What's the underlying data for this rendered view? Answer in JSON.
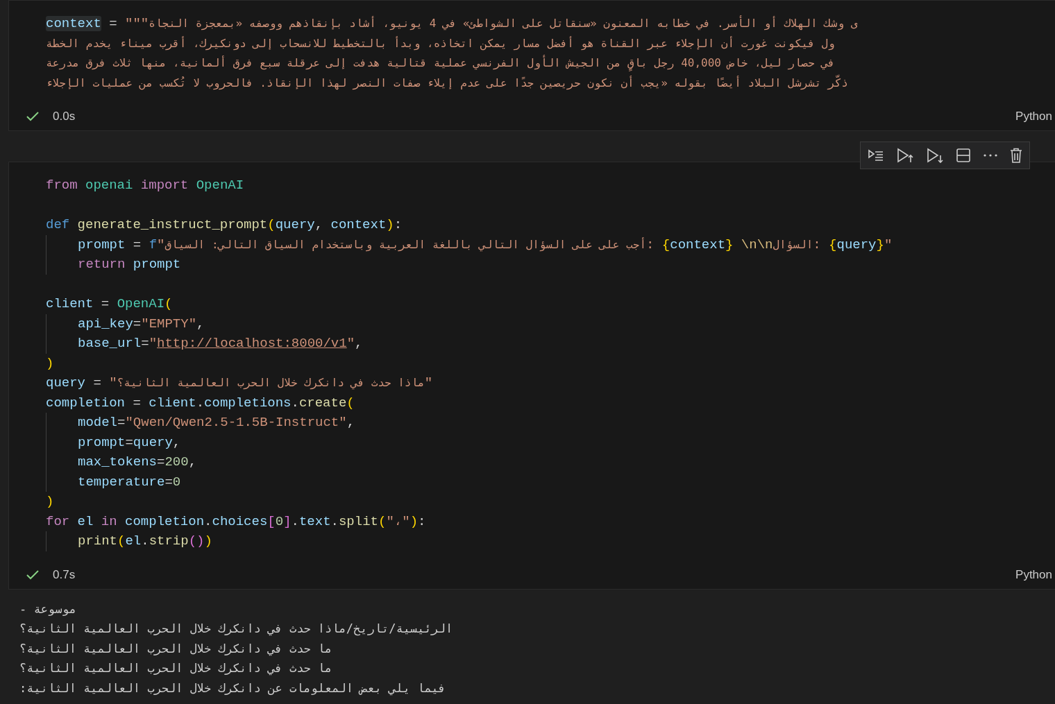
{
  "cells": [
    {
      "kind": "code",
      "lines": [
        {
          "kind": "code",
          "tokens": [
            {
              "t": "context",
              "kind": "varhl"
            },
            {
              "t": " = ",
              "kind": "op"
            },
            {
              "t": "\"\"\"",
              "kind": "str"
            },
            {
              "t": "ى وشك الهلاك أو الأسر. في خطابه المعنون «سنقاتل على الشواطئ» في 4 يونيو، أشاد بإنقاذهم ووصفه «بمعجزة النجاة",
              "kind": "ar"
            }
          ]
        },
        {
          "kind": "code",
          "tokens": [
            {
              "t": "ول فيكونت غورت أن الإجلاء عبر القناة هو أفضل مسار يمكن اتخاذه، وبدأ بالتخطيط للانسحاب إلى دونكيرك، أقرب ميناء يخدم الخطة",
              "kind": "ar"
            }
          ]
        },
        {
          "kind": "code",
          "tokens": [
            {
              "t": "في حصار ليل، خاض 40,000 رجل باقٍ من الجيش الأول الفرنسي عملية قتالية هدفت إلى عرقلة سبع فرق ألمانية، منها ثلاث فرق مدرعة",
              "kind": "ar"
            }
          ]
        },
        {
          "kind": "code",
          "tokens": [
            {
              "t": "ذكّر تشرشل البلاد أيضًا بقوله «يجب أن نكون حريصين جدًا على عدم إيلاء صفات النصر لهذا الإنقاذ. فالحروب لا تُكسب من عمليات الإجلاء",
              "kind": "ar"
            }
          ]
        }
      ],
      "succeeded": true,
      "time": "0.0s",
      "language": "Python",
      "toolbar": false
    },
    {
      "kind": "code",
      "lines": [
        {
          "kind": "code",
          "tokens": [
            {
              "t": "from ",
              "kind": "kw"
            },
            {
              "t": "openai ",
              "kind": "cls"
            },
            {
              "t": "import ",
              "kind": "kw"
            },
            {
              "t": "OpenAI",
              "kind": "cls"
            }
          ]
        },
        {
          "kind": "blank"
        },
        {
          "kind": "code",
          "tokens": [
            {
              "t": "def ",
              "kind": "kw2"
            },
            {
              "t": "generate_instruct_prompt",
              "kind": "fn"
            },
            {
              "t": "(",
              "kind": "br1"
            },
            {
              "t": "query",
              "kind": "var"
            },
            {
              "t": ", ",
              "kind": "op"
            },
            {
              "t": "context",
              "kind": "var"
            },
            {
              "t": ")",
              "kind": "br1"
            },
            {
              "t": ":",
              "kind": "op"
            }
          ],
          "children": [
            {
              "kind": "code",
              "tokens": [
                {
                  "t": "prompt",
                  "kind": "var"
                },
                {
                  "t": " = ",
                  "kind": "op"
                },
                {
                  "t": "f",
                  "kind": "kw2"
                },
                {
                  "t": "\"",
                  "kind": "str"
                },
                {
                  "t": "أجب على على السؤال التالي باللغة العربية وباستخدام السياق التالي: السياق",
                  "kind": "ar"
                },
                {
                  "t": ": ",
                  "kind": "str"
                },
                {
                  "t": "{",
                  "kind": "br1"
                },
                {
                  "t": "context",
                  "kind": "var"
                },
                {
                  "t": "}",
                  "kind": "br1"
                },
                {
                  "t": " \\n\\n",
                  "kind": "esc"
                },
                {
                  "t": "السؤال",
                  "kind": "ar"
                },
                {
                  "t": ": ",
                  "kind": "str"
                },
                {
                  "t": "{",
                  "kind": "br1"
                },
                {
                  "t": "query",
                  "kind": "var"
                },
                {
                  "t": "}",
                  "kind": "br1"
                },
                {
                  "t": "\"",
                  "kind": "str"
                }
              ]
            },
            {
              "kind": "code",
              "tokens": [
                {
                  "t": "return ",
                  "kind": "kw"
                },
                {
                  "t": "prompt",
                  "kind": "var"
                }
              ]
            }
          ]
        },
        {
          "kind": "blank"
        },
        {
          "kind": "code",
          "tokens": [
            {
              "t": "client",
              "kind": "var"
            },
            {
              "t": " = ",
              "kind": "op"
            },
            {
              "t": "OpenAI",
              "kind": "cls"
            },
            {
              "t": "(",
              "kind": "br1"
            }
          ],
          "children": [
            {
              "kind": "code",
              "tokens": [
                {
                  "t": "api_key",
                  "kind": "var"
                },
                {
                  "t": "=",
                  "kind": "op"
                },
                {
                  "t": "\"EMPTY\"",
                  "kind": "str"
                },
                {
                  "t": ",",
                  "kind": "op"
                }
              ]
            },
            {
              "kind": "code",
              "tokens": [
                {
                  "t": "base_url",
                  "kind": "var"
                },
                {
                  "t": "=",
                  "kind": "op"
                },
                {
                  "t": "\"",
                  "kind": "str"
                },
                {
                  "t": "http://localhost:8000/v1",
                  "kind": "url"
                },
                {
                  "t": "\"",
                  "kind": "str"
                },
                {
                  "t": ",",
                  "kind": "op"
                }
              ]
            }
          ]
        },
        {
          "kind": "code",
          "tokens": [
            {
              "t": ")",
              "kind": "br1"
            }
          ]
        },
        {
          "kind": "code",
          "tokens": [
            {
              "t": "query",
              "kind": "var"
            },
            {
              "t": " = ",
              "kind": "op"
            },
            {
              "t": "\"",
              "kind": "str"
            },
            {
              "t": "ماذا حدث في دانكرك خلال الحرب العالمية الثانية؟",
              "kind": "ar"
            },
            {
              "t": "\"",
              "kind": "str"
            }
          ]
        },
        {
          "kind": "code",
          "tokens": [
            {
              "t": "completion",
              "kind": "var"
            },
            {
              "t": " = ",
              "kind": "op"
            },
            {
              "t": "client",
              "kind": "var"
            },
            {
              "t": ".",
              "kind": "op"
            },
            {
              "t": "completions",
              "kind": "var"
            },
            {
              "t": ".",
              "kind": "op"
            },
            {
              "t": "create",
              "kind": "fn"
            },
            {
              "t": "(",
              "kind": "br1"
            }
          ],
          "children": [
            {
              "kind": "code",
              "tokens": [
                {
                  "t": "model",
                  "kind": "var"
                },
                {
                  "t": "=",
                  "kind": "op"
                },
                {
                  "t": "\"Qwen/Qwen2.5-1.5B-Instruct\"",
                  "kind": "str"
                },
                {
                  "t": ",",
                  "kind": "op"
                }
              ]
            },
            {
              "kind": "code",
              "tokens": [
                {
                  "t": "prompt",
                  "kind": "var"
                },
                {
                  "t": "=",
                  "kind": "op"
                },
                {
                  "t": "query",
                  "kind": "var"
                },
                {
                  "t": ",",
                  "kind": "op"
                }
              ]
            },
            {
              "kind": "code",
              "tokens": [
                {
                  "t": "max_tokens",
                  "kind": "var"
                },
                {
                  "t": "=",
                  "kind": "op"
                },
                {
                  "t": "200",
                  "kind": "num"
                },
                {
                  "t": ",",
                  "kind": "op"
                }
              ]
            },
            {
              "kind": "code",
              "tokens": [
                {
                  "t": "temperature",
                  "kind": "var"
                },
                {
                  "t": "=",
                  "kind": "op"
                },
                {
                  "t": "0",
                  "kind": "num"
                }
              ]
            }
          ]
        },
        {
          "kind": "code",
          "tokens": [
            {
              "t": ")",
              "kind": "br1"
            }
          ]
        },
        {
          "kind": "code",
          "tokens": [
            {
              "t": "for ",
              "kind": "kw"
            },
            {
              "t": "el ",
              "kind": "var"
            },
            {
              "t": "in ",
              "kind": "kw"
            },
            {
              "t": "completion",
              "kind": "var"
            },
            {
              "t": ".",
              "kind": "op"
            },
            {
              "t": "choices",
              "kind": "var"
            },
            {
              "t": "[",
              "kind": "br2"
            },
            {
              "t": "0",
              "kind": "num"
            },
            {
              "t": "]",
              "kind": "br2"
            },
            {
              "t": ".",
              "kind": "op"
            },
            {
              "t": "text",
              "kind": "var"
            },
            {
              "t": ".",
              "kind": "op"
            },
            {
              "t": "split",
              "kind": "fn"
            },
            {
              "t": "(",
              "kind": "br1"
            },
            {
              "t": "\"،\"",
              "kind": "str"
            },
            {
              "t": ")",
              "kind": "br1"
            },
            {
              "t": ":",
              "kind": "op"
            }
          ],
          "children": [
            {
              "kind": "code",
              "tokens": [
                {
                  "t": "print",
                  "kind": "fn"
                },
                {
                  "t": "(",
                  "kind": "br1"
                },
                {
                  "t": "el",
                  "kind": "var"
                },
                {
                  "t": ".",
                  "kind": "op"
                },
                {
                  "t": "strip",
                  "kind": "fn"
                },
                {
                  "t": "()",
                  "kind": "br2"
                },
                {
                  "t": ")",
                  "kind": "br1"
                }
              ]
            }
          ]
        }
      ],
      "succeeded": true,
      "time": "0.7s",
      "language": "Python",
      "toolbar": true,
      "output": [
        "موسوعة -",
        "الرئيسية/تاريخ/ماذا حدث في دانكرك خلال الحرب العالمية الثانية؟",
        "ما حدث في دانكرك خلال الحرب العالمية الثانية؟",
        "ما حدث في دانكرك خلال الحرب العالمية الثانية؟",
        "فيما يلي بعض المعلومات عن دانكرك خلال الحرب العالمية الثانية:"
      ]
    }
  ]
}
